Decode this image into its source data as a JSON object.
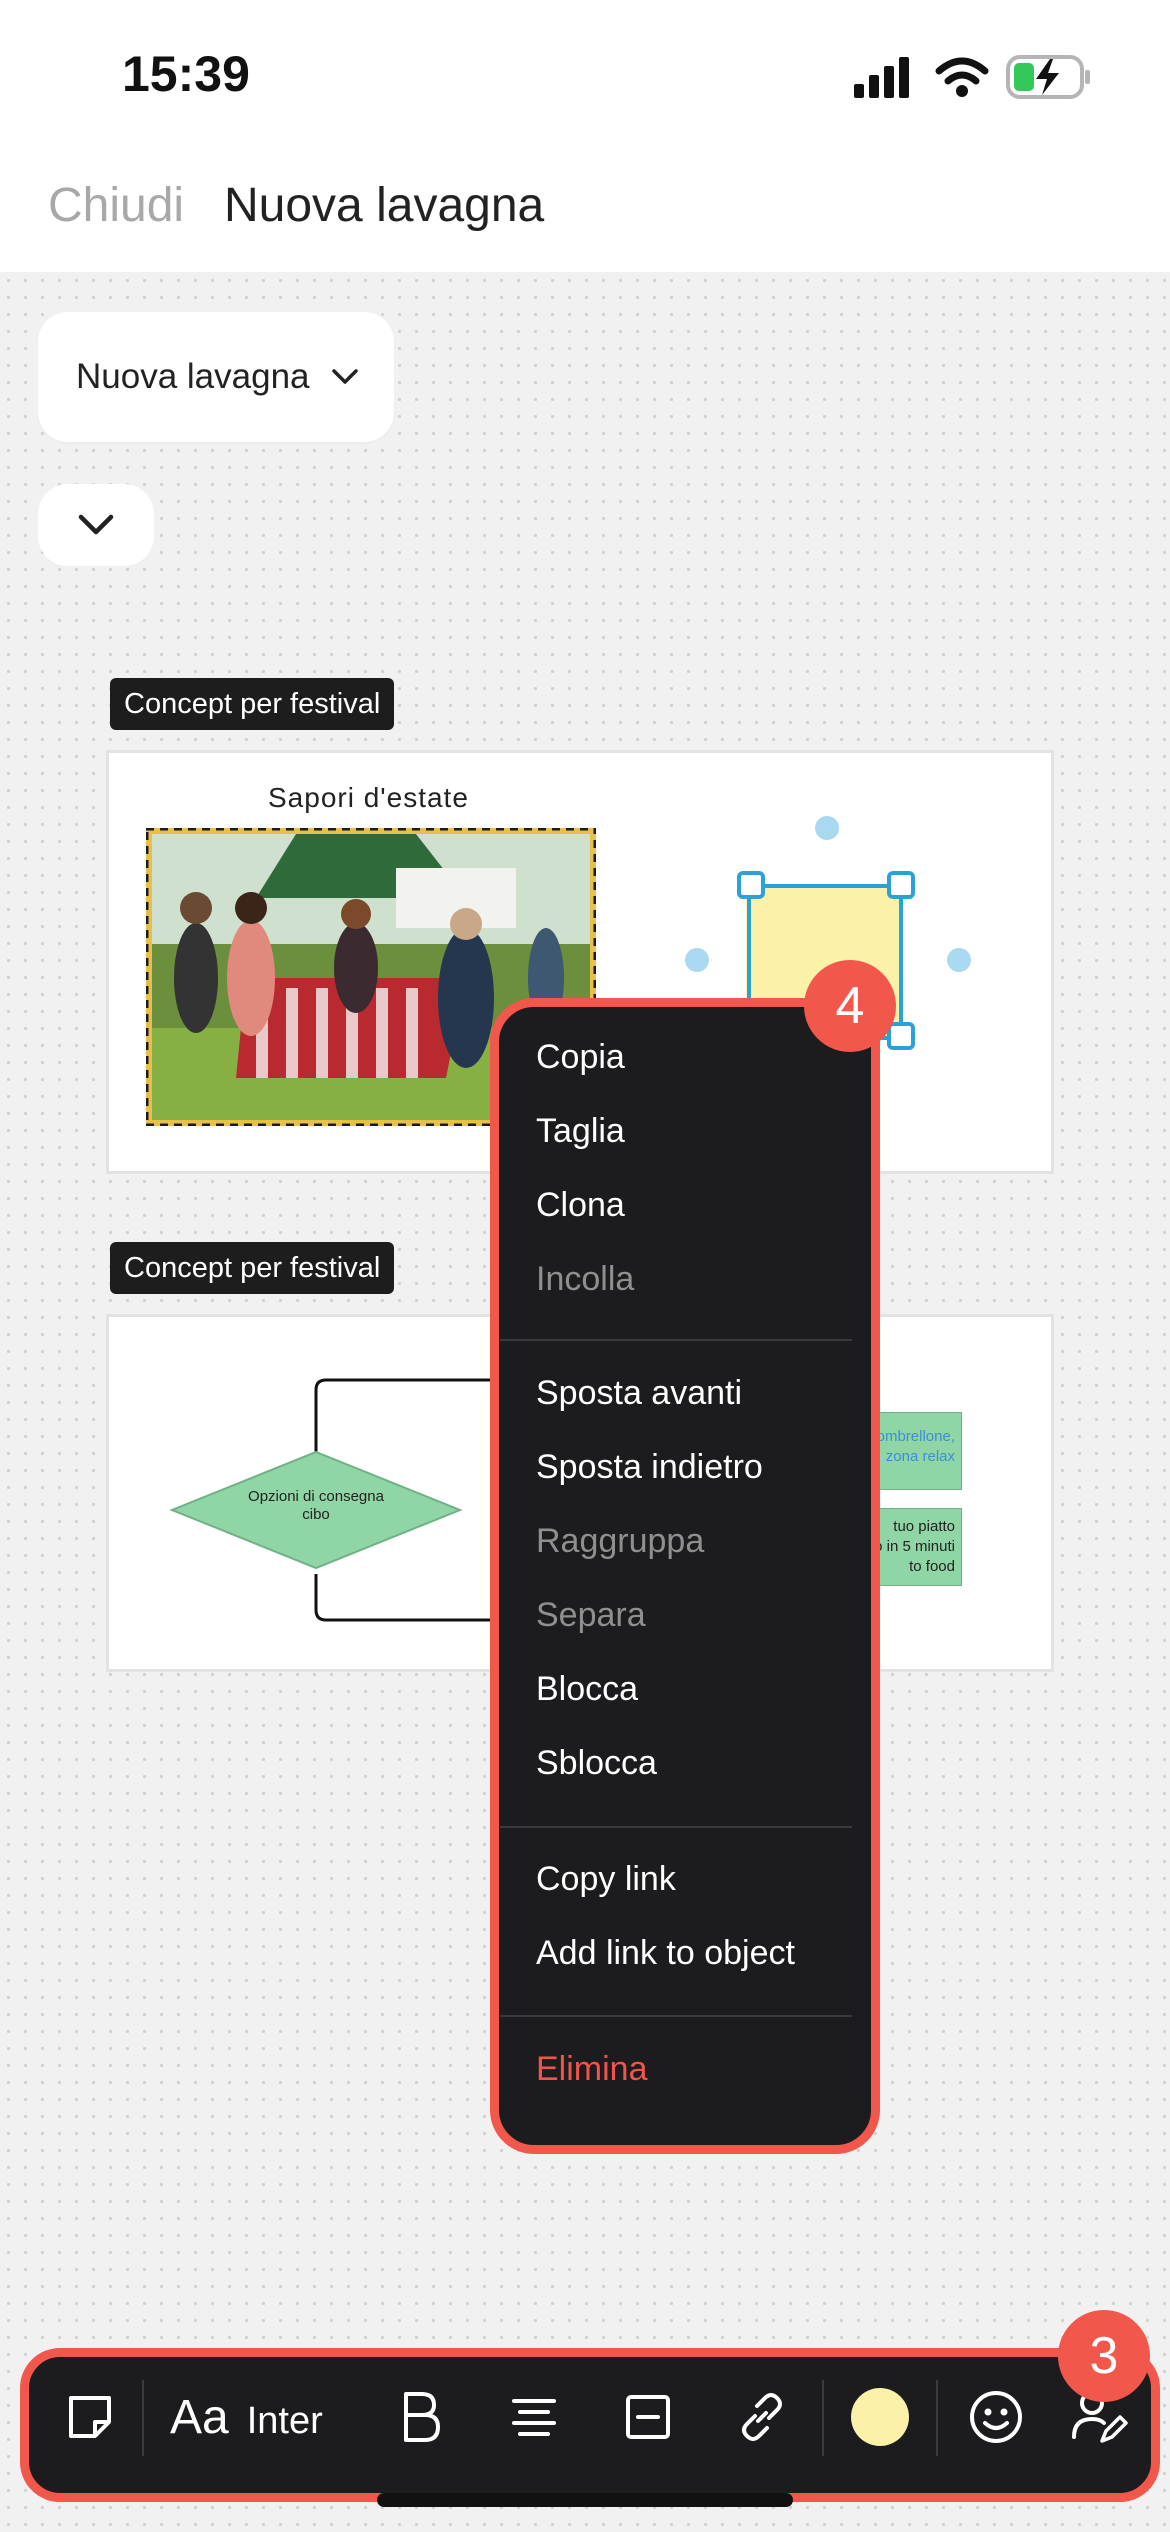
{
  "status_bar": {
    "time": "15:39"
  },
  "nav": {
    "close_label": "Chiudi",
    "title": "Nuova lavagna"
  },
  "board_selector": {
    "label": "Nuova lavagna"
  },
  "frames": [
    {
      "label": "Concept per festival",
      "image_caption": "Sapori d'estate"
    },
    {
      "label": "Concept per festival",
      "decision_text": [
        "Opzioni di consegna",
        "cibo"
      ],
      "note1_text": [
        "ombrellone,",
        "zona relax"
      ],
      "note2_text": [
        "tuo piatto",
        "alo in 5 minuti",
        "to food"
      ]
    }
  ],
  "context_menu": {
    "copy": "Copia",
    "cut": "Taglia",
    "clone": "Clona",
    "paste": "Incolla",
    "bring_forward": "Sposta avanti",
    "send_backward": "Sposta indietro",
    "group": "Raggruppa",
    "ungroup": "Separa",
    "lock": "Blocca",
    "unlock": "Sblocca",
    "copy_link": "Copy link",
    "add_link": "Add link to object",
    "delete": "Elimina"
  },
  "badges": {
    "menu": "4",
    "toolbar": "3"
  },
  "toolbar": {
    "font_icon": "Aa",
    "font_name": "Inter",
    "selected_color": "#fbf1a9"
  },
  "colors": {
    "accent": "#f1574b",
    "menu_bg": "#1c1c1e",
    "danger": "#f0544a",
    "selection": "#2ba1d9",
    "sticky": "#fbf1a9",
    "flow_green": "#90d5a5"
  }
}
